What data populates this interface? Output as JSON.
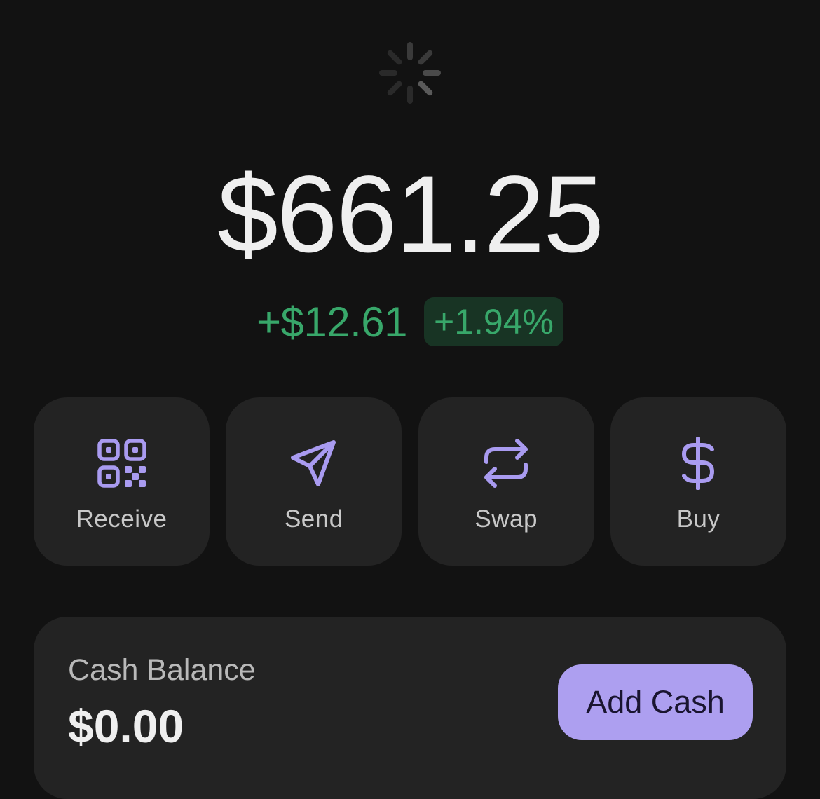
{
  "spinner": {
    "icon": "loading-spinner-icon"
  },
  "portfolio": {
    "balance": "$661.25",
    "change_amount": "+$12.61",
    "change_percent": "+1.94%"
  },
  "actions": [
    {
      "label": "Receive",
      "icon": "qr-code-icon"
    },
    {
      "label": "Send",
      "icon": "paper-plane-icon"
    },
    {
      "label": "Swap",
      "icon": "swap-arrows-icon"
    },
    {
      "label": "Buy",
      "icon": "dollar-sign-icon"
    }
  ],
  "cash": {
    "label": "Cash Balance",
    "value": "$0.00",
    "button_label": "Add Cash"
  },
  "colors": {
    "background": "#121212",
    "card": "#232323",
    "accent": "#ad9ff0",
    "positive": "#38a76a",
    "positive_badge_bg": "#183424"
  }
}
